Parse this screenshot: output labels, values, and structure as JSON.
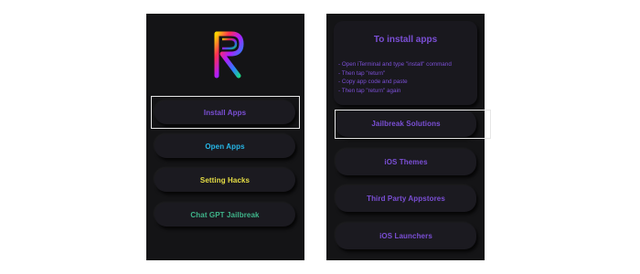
{
  "colors": {
    "background": "#ffffff",
    "screen": "#141416",
    "pill": "#1b1a20",
    "purple": "#7b4fd6",
    "cyan": "#26b6e6",
    "yellow": "#e7df45",
    "green": "#3fb58a",
    "focus": "#e6e6e6"
  },
  "left_screen": {
    "logo_icon": "rainbow-r-logo-icon",
    "buttons": [
      {
        "label": "Install Apps",
        "color": "#7b4fd6",
        "focused": true
      },
      {
        "label": "Open Apps",
        "color": "#26b6e6",
        "focused": false
      },
      {
        "label": "Setting Hacks",
        "color": "#e7df45",
        "focused": false
      },
      {
        "label": "Chat GPT Jailbreak",
        "color": "#3fb58a",
        "focused": false
      }
    ]
  },
  "right_screen": {
    "info_card": {
      "title": "To install apps",
      "steps": [
        "- Open iTerminal and type \"install\" command",
        "- Then tap \"return\"",
        "- Copy app code and paste",
        "- Then tap \"return\" again"
      ]
    },
    "buttons": [
      {
        "label": "Jailbreak Solutions",
        "color": "#7b4fd6",
        "focused": true
      },
      {
        "label": "iOS Themes",
        "color": "#7b4fd6",
        "focused": false
      },
      {
        "label": "Third Party Appstores",
        "color": "#7b4fd6",
        "focused": false
      },
      {
        "label": "iOS Launchers",
        "color": "#7b4fd6",
        "focused": false
      }
    ]
  }
}
